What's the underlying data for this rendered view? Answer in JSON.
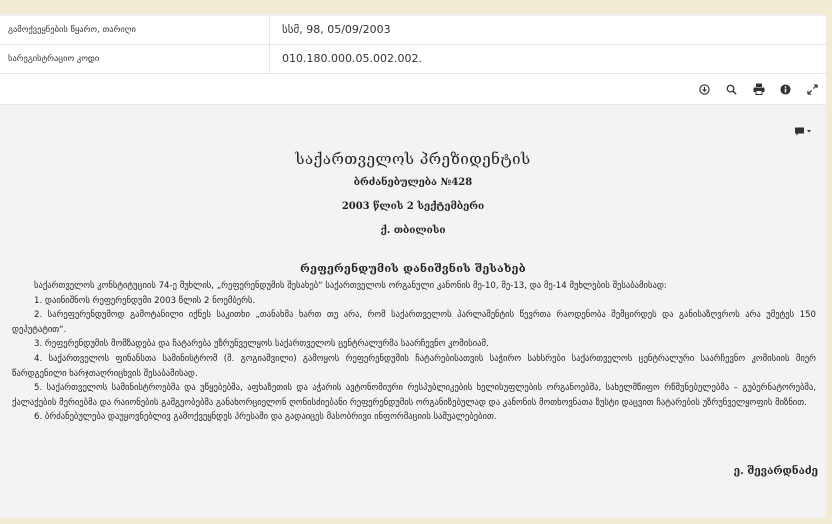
{
  "meta": {
    "rows": [
      {
        "label": "გამოქვეყნების წყარო, თარიღი",
        "value": "სსმ, 98, 05/09/2003"
      },
      {
        "label": "სარეგისტრაციო კოდი",
        "value": "010.180.000.05.002.002."
      }
    ]
  },
  "toolbar": {
    "icons": [
      "download-icon",
      "search-icon",
      "print-icon",
      "info-icon",
      "expand-icon"
    ]
  },
  "document": {
    "title": "საქართველოს პრეზიდენტის",
    "decree": "ბრძანებულება №428",
    "date": "2003 წლის 2 სექტემბერი",
    "city": "ქ. თბილისი",
    "heading": "რეფერენდუმის დანიშვნის შესახებ",
    "paragraphs": [
      "საქართველოს კონსტიტუციის 74-ე მუხლის, „რეფერენდუმის შესახებ“ საქართველოს ორგანული კანონის მე-10, მე-13, და მე-14 მუხლების შესაბამისად:",
      "1. დაინიშნოს რეფერენდუმი 2003 წლის 2 ნოემბერს.",
      "2. სარეფერენდუმოდ გამოტანილი იქნეს საკითხი „თანახმა ხართ თუ არა, რომ საქართველოს პარლამენტის წევრთა რაოდენობა შემცირდეს და განისაზღვროს არა უმეტეს 150 დეპუტატით“.",
      "3. რეფერენდუმის მომზადება და ჩატარება უზრუნველყოს საქართველოს ცენტრალურმა საარჩევნო კომისიამ.",
      "4. საქართველოს ფინანსთა სამინისტრომ (მ. გოგიაშვილი) გამოყოს რეფერენდუმის ჩატარებისათვის საჭირო სახსრები საქართველოს ცენტრალური საარჩევნო კომისიის მიერ წარდგენილი ხარჯთაღრიცხვის შესაბამისად.",
      "5. საქართველოს სამინისტროებმა და უწყებებმა, აფხაზეთის და აჭარის ავტონომიური რესპუბლიკების ხელისუფლების ორგანოებმა, სახელმწიფო რწმუნებულებმა – გუბერნატორებმა, ქალაქების მერიებმა და რაიონების გამგეობებმა განახორციელონ ღონისძიებანი რეფერენდუმის ორგანიზებულად და კანონის მოთხოვნათა ზუსტი დაცვით ჩატარების უზრუნველყოფის მიზნით.",
      "6. ბრძანებულება დაუყოვნებლივ გამოქვეყნდეს პრესაში და გადაიცეს მასობრივი ინფორმაციის საშუალებებით."
    ],
    "signature": "ე. შევარდნაძე"
  }
}
